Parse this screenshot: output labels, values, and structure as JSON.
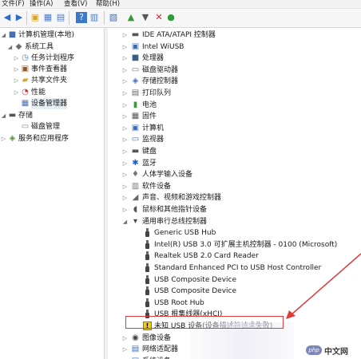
{
  "menu": [
    "文件(F)",
    "操作(A)",
    "查看(V)",
    "帮助(H)"
  ],
  "toolbar_icons": [
    "back-icon",
    "forward-icon",
    "folder-up-icon",
    "show-hide-tree-icon",
    "properties-icon",
    "help-icon",
    "view-icon",
    "scan-hardware-icon",
    "update-driver-icon",
    "disable-device-icon",
    "uninstall-device-icon"
  ],
  "left_tree": [
    {
      "label": "计算机管理(本地)",
      "depth": 0,
      "expand": "open",
      "icon": "computer-mgmt-icon"
    },
    {
      "label": "系统工具",
      "depth": 1,
      "expand": "open",
      "icon": "tools-icon"
    },
    {
      "label": "任务计划程序",
      "depth": 2,
      "expand": "closed",
      "icon": "task-scheduler-icon"
    },
    {
      "label": "事件查看器",
      "depth": 2,
      "expand": "closed",
      "icon": "event-viewer-icon"
    },
    {
      "label": "共享文件夹",
      "depth": 2,
      "expand": "closed",
      "icon": "shared-folder-icon"
    },
    {
      "label": "性能",
      "depth": 2,
      "expand": "closed",
      "icon": "performance-icon"
    },
    {
      "label": "设备管理器",
      "depth": 2,
      "expand": "none",
      "icon": "device-manager-icon",
      "selected": true
    },
    {
      "label": "存储",
      "depth": 0,
      "expand": "open",
      "icon": "storage-icon"
    },
    {
      "label": "磁盘管理",
      "depth": 2,
      "expand": "none",
      "icon": "disk-mgmt-icon"
    },
    {
      "label": "服务和应用程序",
      "depth": 0,
      "expand": "closed",
      "icon": "services-icon"
    }
  ],
  "device_tree": [
    {
      "label": "IDE ATA/ATAPI 控制器",
      "type": "cat",
      "icon": "ide-icon"
    },
    {
      "label": "Intel WiUSB",
      "type": "cat",
      "icon": "wiusb-icon"
    },
    {
      "label": "处理器",
      "type": "cat",
      "icon": "processor-icon"
    },
    {
      "label": "磁盘驱动器",
      "type": "cat",
      "icon": "disk-drive-icon"
    },
    {
      "label": "存储控制器",
      "type": "cat",
      "icon": "storage-controller-icon"
    },
    {
      "label": "打印队列",
      "type": "cat",
      "icon": "print-queue-icon"
    },
    {
      "label": "电池",
      "type": "cat",
      "icon": "battery-icon"
    },
    {
      "label": "固件",
      "type": "cat",
      "icon": "firmware-icon"
    },
    {
      "label": "计算机",
      "type": "cat",
      "icon": "computer-icon"
    },
    {
      "label": "监视器",
      "type": "cat",
      "icon": "monitor-icon"
    },
    {
      "label": "键盘",
      "type": "cat",
      "icon": "keyboard-icon"
    },
    {
      "label": "蓝牙",
      "type": "cat",
      "icon": "bluetooth-icon"
    },
    {
      "label": "人体学输入设备",
      "type": "cat",
      "icon": "hid-icon"
    },
    {
      "label": "软件设备",
      "type": "cat",
      "icon": "software-device-icon"
    },
    {
      "label": "声音、视频和游戏控制器",
      "type": "cat",
      "icon": "sound-icon"
    },
    {
      "label": "鼠标和其他指针设备",
      "type": "cat",
      "icon": "mouse-icon"
    },
    {
      "label": "通用串行总线控制器",
      "type": "open",
      "icon": "usb-controller-icon"
    },
    {
      "label": "Generic USB Hub",
      "type": "child",
      "icon": "usb-icon"
    },
    {
      "label": "Intel(R) USB 3.0 可扩展主机控制器 - 0100 (Microsoft)",
      "type": "child",
      "icon": "usb-icon"
    },
    {
      "label": "Realtek USB 2.0 Card Reader",
      "type": "child",
      "icon": "usb-icon"
    },
    {
      "label": "Standard Enhanced PCI to USB Host Controller",
      "type": "child",
      "icon": "usb-icon"
    },
    {
      "label": "USB Composite Device",
      "type": "child",
      "icon": "usb-icon"
    },
    {
      "label": "USB Composite Device",
      "type": "child",
      "icon": "usb-icon"
    },
    {
      "label": "USB Root Hub",
      "type": "child",
      "icon": "usb-icon"
    },
    {
      "label": "USB 根集线器(xHCI)",
      "type": "child",
      "icon": "usb-icon"
    },
    {
      "label": "未知 USB 设备(设备描述符请求失败)",
      "type": "warn",
      "icon": "warning-icon"
    },
    {
      "label": "图像设备",
      "type": "cat",
      "icon": "imaging-icon"
    },
    {
      "label": "网络适配器",
      "type": "cat",
      "icon": "network-adapter-icon"
    },
    {
      "label": "系统设备",
      "type": "cat",
      "icon": "system-device-icon"
    }
  ],
  "watermark": {
    "logo": "php",
    "text": "中文网"
  },
  "colors": {
    "highlight": "#e03a3a",
    "selection": "#e6eef8"
  }
}
